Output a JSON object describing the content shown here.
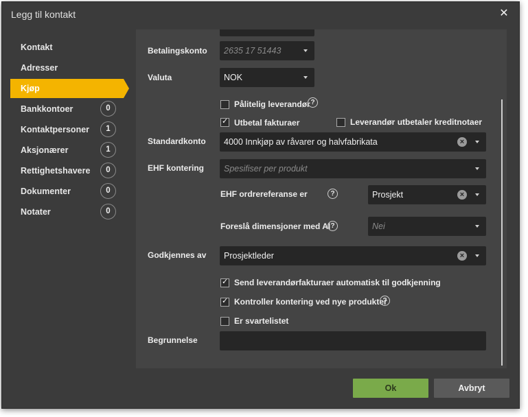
{
  "dialog": {
    "title": "Legg til kontakt",
    "close_icon": "close-icon"
  },
  "nav": [
    {
      "label": "Kontakt",
      "badge": null,
      "active": false
    },
    {
      "label": "Adresser",
      "badge": null,
      "active": false
    },
    {
      "label": "Kjøp",
      "badge": null,
      "active": true
    },
    {
      "label": "Bankkontoer",
      "badge": "0",
      "active": false
    },
    {
      "label": "Kontaktpersoner",
      "badge": "1",
      "active": false
    },
    {
      "label": "Aksjonærer",
      "badge": "1",
      "active": false
    },
    {
      "label": "Rettighetshavere",
      "badge": "0",
      "active": false
    },
    {
      "label": "Dokumenter",
      "badge": "0",
      "active": false
    },
    {
      "label": "Notater",
      "badge": "0",
      "active": false
    }
  ],
  "form": {
    "betalingskonto": {
      "label": "Betalingskonto",
      "placeholder": "2635 17 51443"
    },
    "valuta": {
      "label": "Valuta",
      "value": "NOK"
    },
    "palitelig": {
      "label": "Pålitelig leverandør",
      "checked": false
    },
    "utbetal": {
      "label": "Utbetal fakturaer",
      "checked": true
    },
    "kreditnotaer": {
      "label": "Leverandør utbetaler kreditnotaer",
      "checked": false
    },
    "standardkonto": {
      "label": "Standardkonto",
      "value": "4000 Innkjøp av råvarer og halvfabrikata"
    },
    "ehf_kontering": {
      "label": "EHF kontering",
      "placeholder": "Spesifiser per produkt"
    },
    "ehf_ordreref": {
      "label": "EHF ordrereferanse er",
      "value": "Prosjekt"
    },
    "dimensjoner": {
      "label": "Foreslå dimensjoner med AI",
      "placeholder": "Nei"
    },
    "godkjennes": {
      "label": "Godkjennes av",
      "value": "Prosjektleder"
    },
    "send_godkjenning": {
      "label": "Send leverandørfakturaer automatisk til godkjenning",
      "checked": true
    },
    "kontroller": {
      "label": "Kontroller kontering ved nye produkter",
      "checked": true
    },
    "svartelistet": {
      "label": "Er svartelistet",
      "checked": false
    },
    "begrunnelse": {
      "label": "Begrunnelse",
      "value": ""
    }
  },
  "buttons": {
    "ok": "Ok",
    "cancel": "Avbryt"
  },
  "colors": {
    "accent": "#f4b400",
    "ok": "#7aaa4a",
    "background": "#3b3b3b",
    "input": "#262626"
  }
}
